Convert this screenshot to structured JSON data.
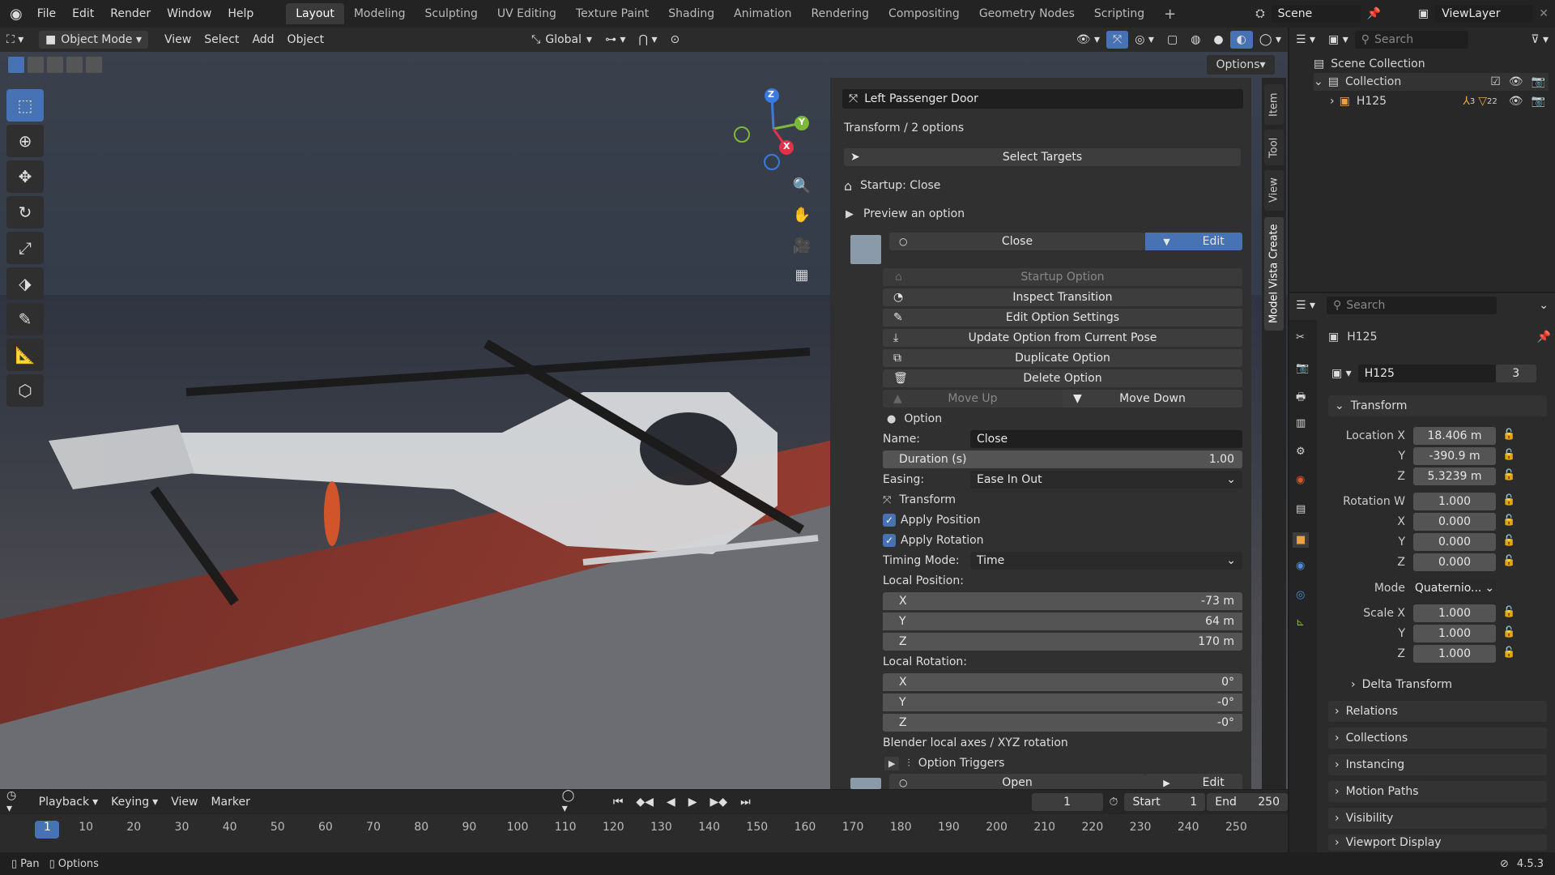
{
  "menu": [
    "File",
    "Edit",
    "Render",
    "Window",
    "Help"
  ],
  "workspaces": [
    "Layout",
    "Modeling",
    "Sculpting",
    "UV Editing",
    "Texture Paint",
    "Shading",
    "Animation",
    "Rendering",
    "Compositing",
    "Geometry Nodes",
    "Scripting"
  ],
  "scene": {
    "name": "Scene",
    "view_layer": "ViewLayer"
  },
  "vp_header": {
    "mode": "Object Mode",
    "view": "View",
    "select": "Select",
    "add": "Add",
    "object": "Object",
    "orientation": "Global",
    "options": "Options"
  },
  "gizmo": {
    "x": "X",
    "y": "Y",
    "z": "Z"
  },
  "panel": {
    "title": "Left Passenger Door",
    "subtitle": "Transform / 2 options",
    "select_targets": "Select Targets",
    "startup": "Startup: Close",
    "preview": "Preview an option",
    "option_close": "Close",
    "edit": "Edit",
    "startup_option": "Startup Option",
    "inspect": "Inspect Transition",
    "edit_settings": "Edit Option Settings",
    "update": "Update Option from Current Pose",
    "duplicate": "Duplicate Option",
    "delete": "Delete Option",
    "move_up": "Move Up",
    "move_down": "Move Down",
    "option": "Option",
    "name_label": "Name:",
    "name_value": "Close",
    "duration_label": "Duration (s)",
    "duration_value": "1.00",
    "easing_label": "Easing:",
    "easing_value": "Ease In Out",
    "transform": "Transform",
    "apply_position": "Apply Position",
    "apply_rotation": "Apply Rotation",
    "timing_label": "Timing Mode:",
    "timing_value": "Time",
    "local_position": "Local Position:",
    "pos": [
      {
        "axis": "X",
        "value": "-73 m"
      },
      {
        "axis": "Y",
        "value": "64 m"
      },
      {
        "axis": "Z",
        "value": "170 m"
      }
    ],
    "local_rotation": "Local Rotation:",
    "rot": [
      {
        "axis": "X",
        "value": "0°"
      },
      {
        "axis": "Y",
        "value": "-0°"
      },
      {
        "axis": "Z",
        "value": "-0°"
      }
    ],
    "axes_note": "Blender local axes / XYZ rotation",
    "option_triggers": "Option Triggers",
    "option_open": "Open",
    "edit2": "Edit"
  },
  "vtabs": [
    "Item",
    "Tool",
    "View",
    "Model Vista Create"
  ],
  "outliner": {
    "search": "Search",
    "scene_collection": "Scene Collection",
    "collection": "Collection",
    "object": "H125",
    "sub1": "3",
    "sub2": "22"
  },
  "props": {
    "search": "Search",
    "object_name": "H125",
    "data_name": "H125",
    "users": "3",
    "transform": "Transform",
    "location_label": "Location X",
    "loc": {
      "x": "18.406 m",
      "y": "-390.9 m",
      "z": "5.3239 m"
    },
    "rotation_label": "Rotation W",
    "rot": {
      "w": "1.000",
      "x": "0.000",
      "y": "0.000",
      "z": "0.000"
    },
    "mode_label": "Mode",
    "mode_value": "Quaternio...",
    "scale_label": "Scale X",
    "scale": {
      "x": "1.000",
      "y": "1.000",
      "z": "1.000"
    },
    "y": "Y",
    "z": "Z",
    "x": "X",
    "sections": [
      "Delta Transform",
      "Relations",
      "Collections",
      "Instancing",
      "Motion Paths",
      "Visibility",
      "Viewport Display"
    ]
  },
  "timeline": {
    "playback": "Playback",
    "keying": "Keying",
    "view": "View",
    "marker": "Marker",
    "current": "1",
    "start_label": "Start",
    "start": "1",
    "end_label": "End",
    "end": "250",
    "ticks": [
      "1",
      "10",
      "20",
      "30",
      "40",
      "50",
      "60",
      "70",
      "80",
      "90",
      "100",
      "110",
      "120",
      "130",
      "140",
      "150",
      "160",
      "170",
      "180",
      "190",
      "200",
      "210",
      "220",
      "230",
      "240",
      "250"
    ]
  },
  "status": {
    "pan": "Pan",
    "options": "Options",
    "version": "4.5.3"
  }
}
